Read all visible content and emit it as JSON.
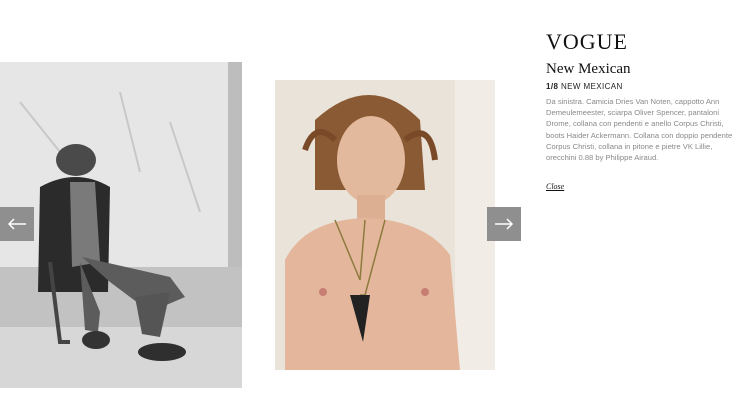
{
  "brand": {
    "logo_text": "VOGUE"
  },
  "gallery": {
    "title": "New Mexican",
    "counter_position": "1/8",
    "counter_label": "NEW MEXICAN",
    "caption": "Da sinistra. Camicia Dries Van Noten, cappotto Ann Demeulemeester, sciarpa Oliver Spencer, pantaloni Drome, collana con pendenti e anello Corpus Christi, boots Haider Ackermann. Collana con doppio pendente Corpus Christi, collana in pitone e pietre VK Lillie, orecchini 0.88 by Philippe Airaud.",
    "close_label": "Close"
  },
  "navigation": {
    "prev_icon": "arrow-left-icon",
    "next_icon": "arrow-right-icon",
    "button_color": "#8f8f8f"
  }
}
